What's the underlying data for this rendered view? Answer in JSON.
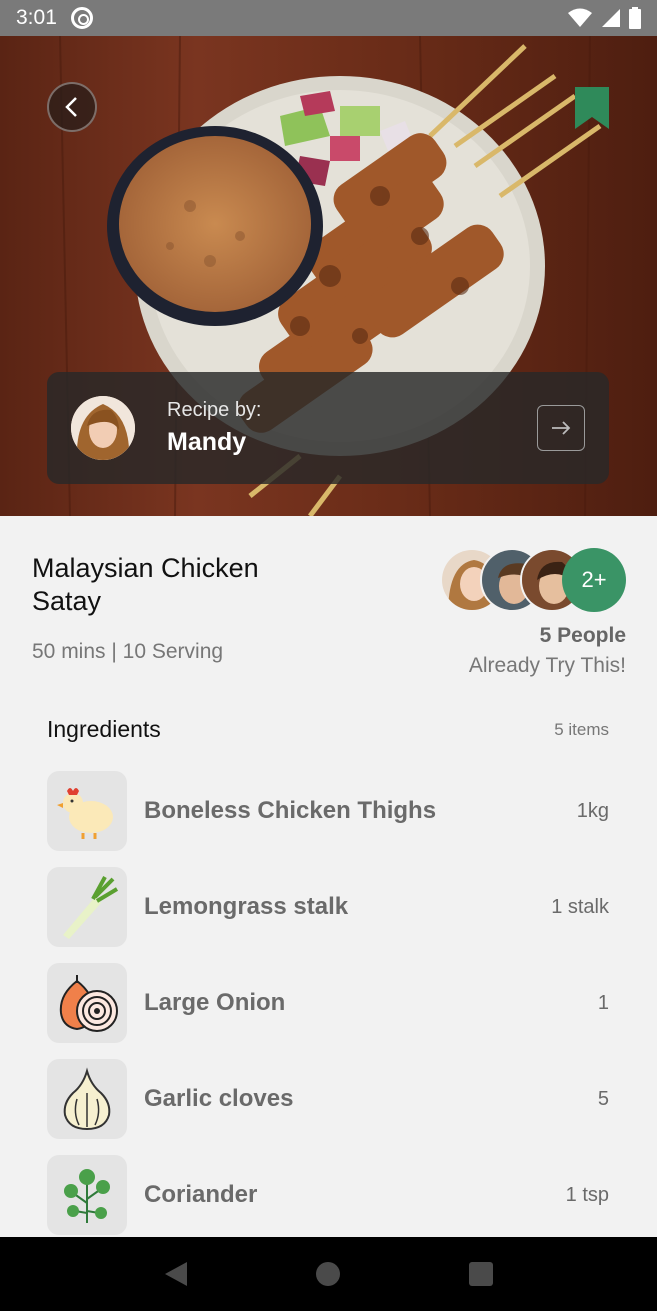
{
  "status_bar": {
    "time": "3:01"
  },
  "author": {
    "caption": "Recipe by:",
    "name": "Mandy"
  },
  "recipe": {
    "title": "Malaysian Chicken Satay",
    "meta": "50 mins | 10 Serving"
  },
  "tried": {
    "extra": "2+",
    "count": "5 People",
    "caption": "Already Try This!"
  },
  "ingredients": {
    "title": "Ingredients",
    "count": "5 items",
    "items": [
      {
        "name": "Boneless Chicken Thighs",
        "qty": "1kg",
        "icon": "chicken-icon"
      },
      {
        "name": "Lemongrass stalk",
        "qty": "1 stalk",
        "icon": "lemongrass-icon"
      },
      {
        "name": "Large Onion",
        "qty": "1",
        "icon": "onion-icon"
      },
      {
        "name": "Garlic cloves",
        "qty": "5",
        "icon": "garlic-icon"
      },
      {
        "name": "Coriander",
        "qty": "1 tsp",
        "icon": "coriander-icon"
      }
    ]
  },
  "colors": {
    "accent": "#3a9466",
    "bookmark": "#2f8a5a",
    "background": "#f2f2f2"
  }
}
